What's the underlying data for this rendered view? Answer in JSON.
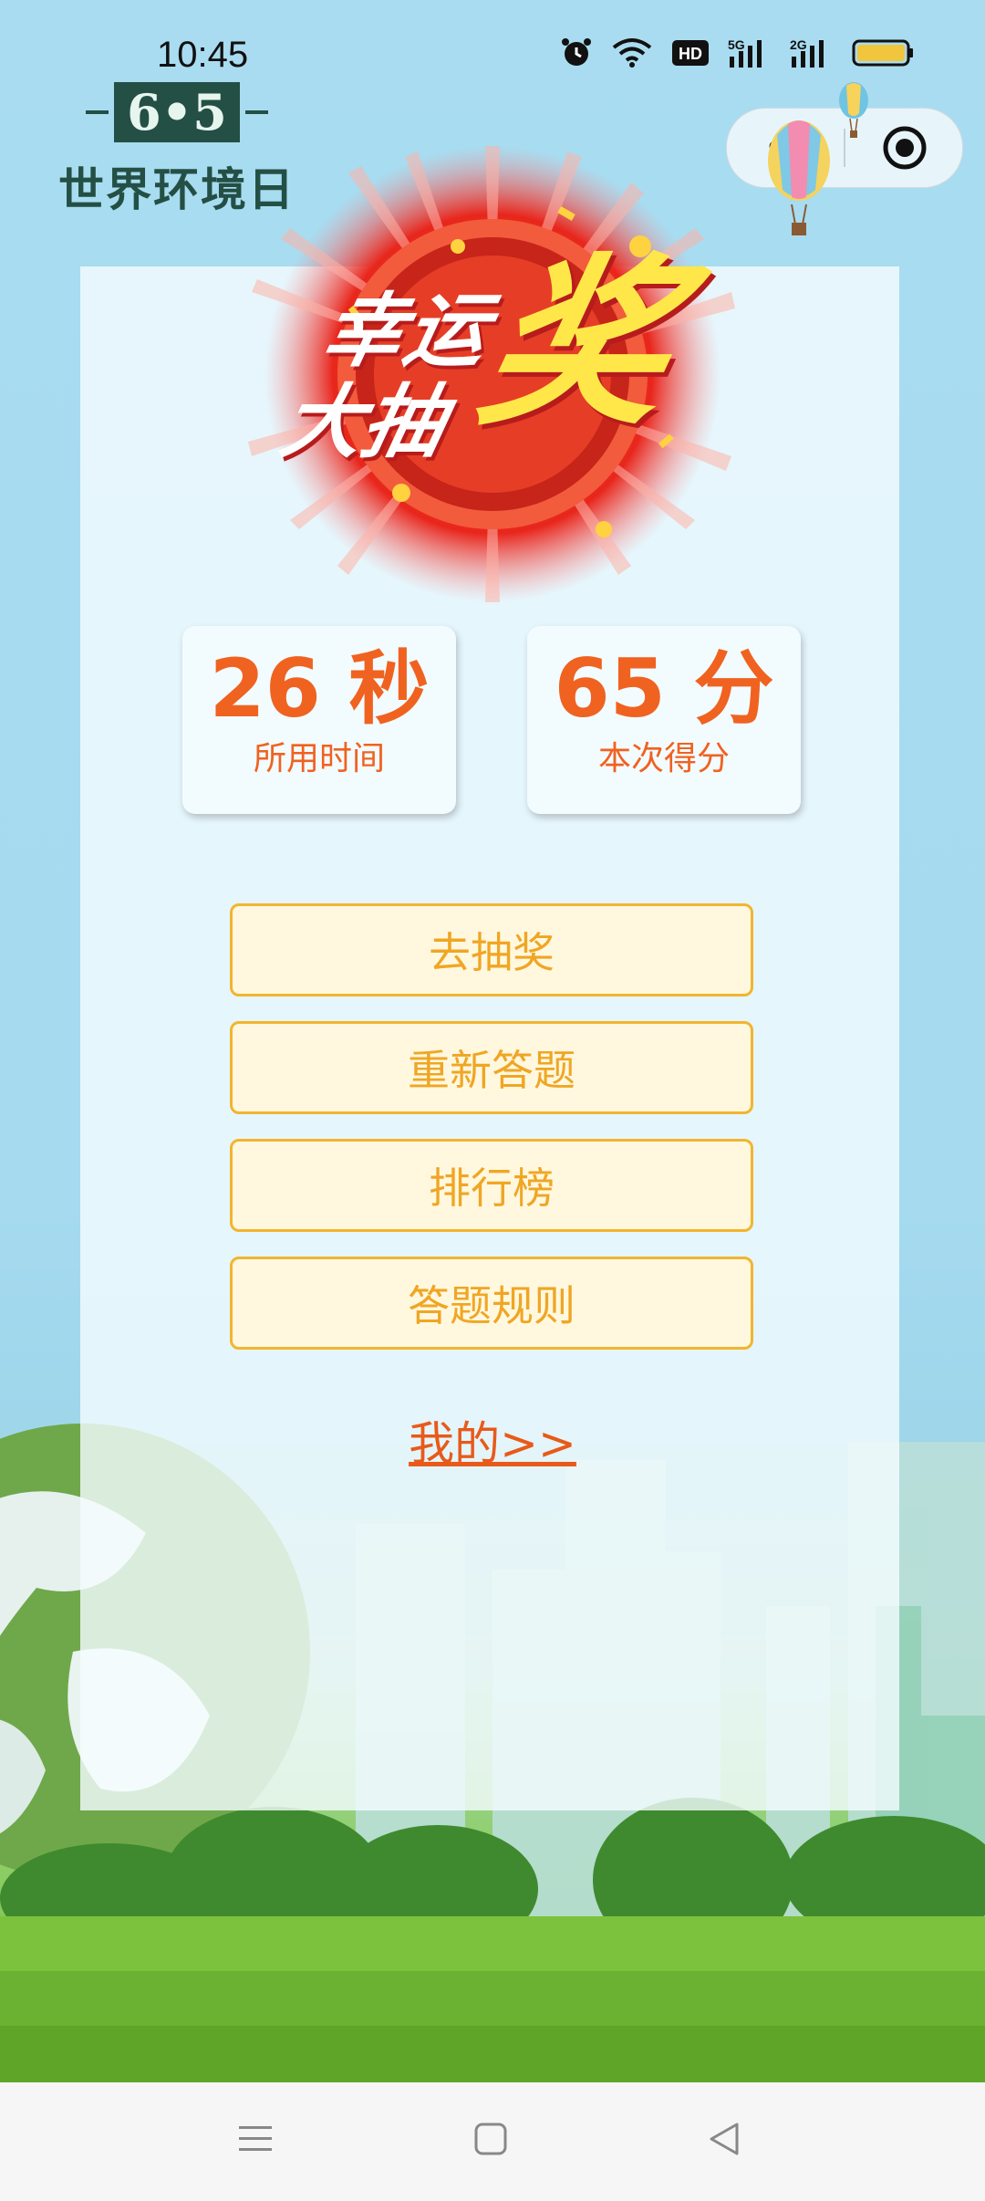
{
  "status_bar": {
    "time": "10:45",
    "icons": [
      "alarm-icon",
      "wifi-icon",
      "hd-icon",
      "signal-5g-icon",
      "signal-2g-icon",
      "battery-icon"
    ],
    "labels": {
      "hd": "HD",
      "net5g": "5G",
      "net2g": "2G"
    }
  },
  "logo": {
    "number": "6•5",
    "text": "世界环境日"
  },
  "capsule": {
    "more": "•••"
  },
  "badge": {
    "line1": "幸运",
    "line2": "大抽",
    "big": "奖"
  },
  "stats": {
    "time_value": "26 秒",
    "time_label": "所用时间",
    "score_value": "65 分",
    "score_label": "本次得分"
  },
  "buttons": {
    "lottery": "去抽奖",
    "retry": "重新答题",
    "ranking": "排行榜",
    "rules": "答题规则"
  },
  "mine_link": "我的>>",
  "colors": {
    "accent_orange": "#f06220",
    "button_border": "#f2b52f",
    "button_text": "#f0a623",
    "button_bg": "#fff8df"
  }
}
